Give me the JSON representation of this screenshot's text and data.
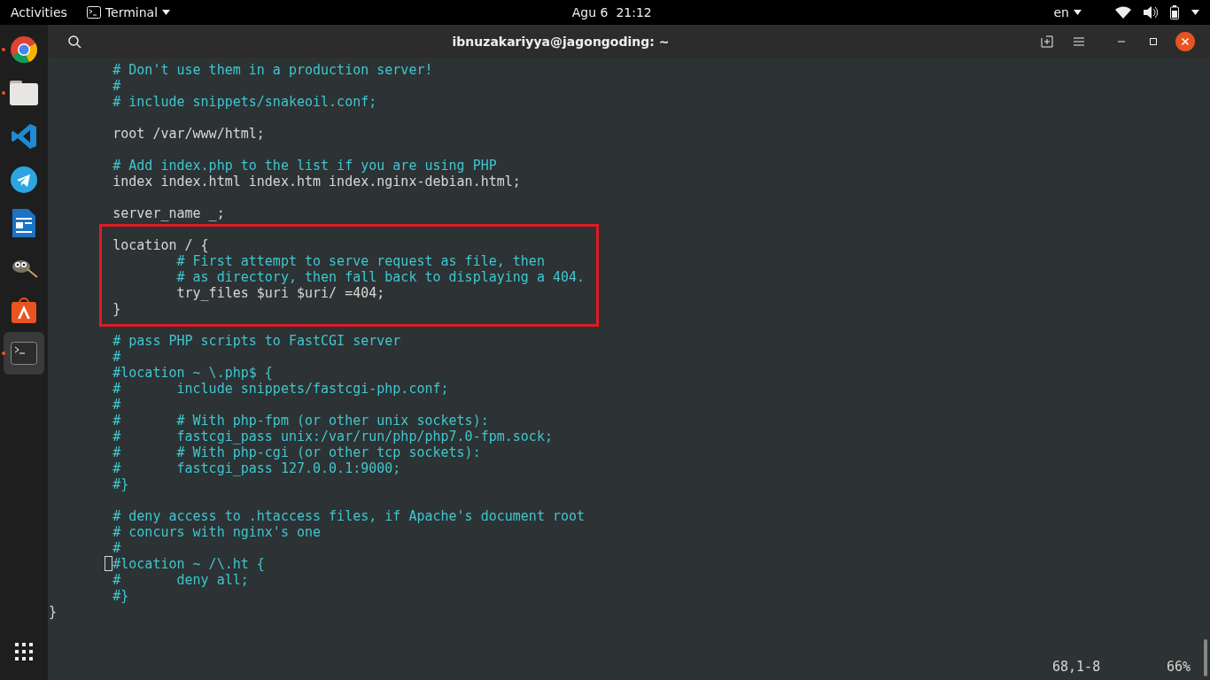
{
  "top_bar": {
    "activities": "Activities",
    "app_menu": "Terminal",
    "clock": "Agu 6  21:12",
    "language": "en"
  },
  "dock": {
    "items": [
      {
        "kind": "browser",
        "running": true,
        "selected": false
      },
      {
        "kind": "files",
        "running": true,
        "selected": false
      },
      {
        "kind": "code",
        "running": false,
        "selected": false
      },
      {
        "kind": "messenger",
        "running": false,
        "selected": false
      },
      {
        "kind": "writer",
        "running": false,
        "selected": false
      },
      {
        "kind": "gimp",
        "running": false,
        "selected": false
      },
      {
        "kind": "store",
        "running": false,
        "selected": false
      },
      {
        "kind": "terminal",
        "running": true,
        "selected": true
      }
    ]
  },
  "window": {
    "title": "ibnuzakariyya@jagongoding: ~"
  },
  "editor": {
    "lines": [
      {
        "kind": "comment",
        "text": "        # Don't use them in a production server!"
      },
      {
        "kind": "comment",
        "text": "        #"
      },
      {
        "kind": "comment",
        "text": "        # include snippets/snakeoil.conf;"
      },
      {
        "kind": "blank"
      },
      {
        "kind": "code",
        "text": "        root /var/www/html;"
      },
      {
        "kind": "blank"
      },
      {
        "kind": "comment",
        "text": "        # Add index.php to the list if you are using PHP"
      },
      {
        "kind": "code",
        "text": "        index index.html index.htm index.nginx-debian.html;"
      },
      {
        "kind": "blank"
      },
      {
        "kind": "code",
        "text": "        server_name _;"
      },
      {
        "kind": "blank"
      },
      {
        "kind": "code",
        "text": "        location / {",
        "highlighted": true
      },
      {
        "kind": "comment",
        "text": "                # First attempt to serve request as file, then",
        "highlighted": true
      },
      {
        "kind": "comment",
        "text": "                # as directory, then fall back to displaying a 404.",
        "highlighted": true
      },
      {
        "kind": "code",
        "text": "                try_files $uri $uri/ =404;",
        "highlighted": true
      },
      {
        "kind": "code",
        "text": "        }",
        "highlighted": true
      },
      {
        "kind": "blank"
      },
      {
        "kind": "comment",
        "text": "        # pass PHP scripts to FastCGI server"
      },
      {
        "kind": "comment",
        "text": "        #"
      },
      {
        "kind": "comment",
        "text": "        #location ~ \\.php$ {"
      },
      {
        "kind": "comment",
        "text": "        #       include snippets/fastcgi-php.conf;"
      },
      {
        "kind": "comment",
        "text": "        #"
      },
      {
        "kind": "comment",
        "text": "        #       # With php-fpm (or other unix sockets):"
      },
      {
        "kind": "comment",
        "text": "        #       fastcgi_pass unix:/var/run/php/php7.0-fpm.sock;"
      },
      {
        "kind": "comment",
        "text": "        #       # With php-cgi (or other tcp sockets):"
      },
      {
        "kind": "comment",
        "text": "        #       fastcgi_pass 127.0.0.1:9000;"
      },
      {
        "kind": "comment",
        "text": "        #}"
      },
      {
        "kind": "blank"
      },
      {
        "kind": "comment",
        "text": "        # deny access to .htaccess files, if Apache's document root"
      },
      {
        "kind": "comment",
        "text": "        # concurs with nginx's one"
      },
      {
        "kind": "comment",
        "text": "        #"
      },
      {
        "kind": "comment",
        "text": "        #location ~ /\\.ht {",
        "cursor": true
      },
      {
        "kind": "comment",
        "text": "        #       deny all;"
      },
      {
        "kind": "comment",
        "text": "        #}"
      },
      {
        "kind": "code",
        "text": "}"
      }
    ],
    "status": {
      "position": "68,1-8",
      "percent": "66%"
    }
  }
}
